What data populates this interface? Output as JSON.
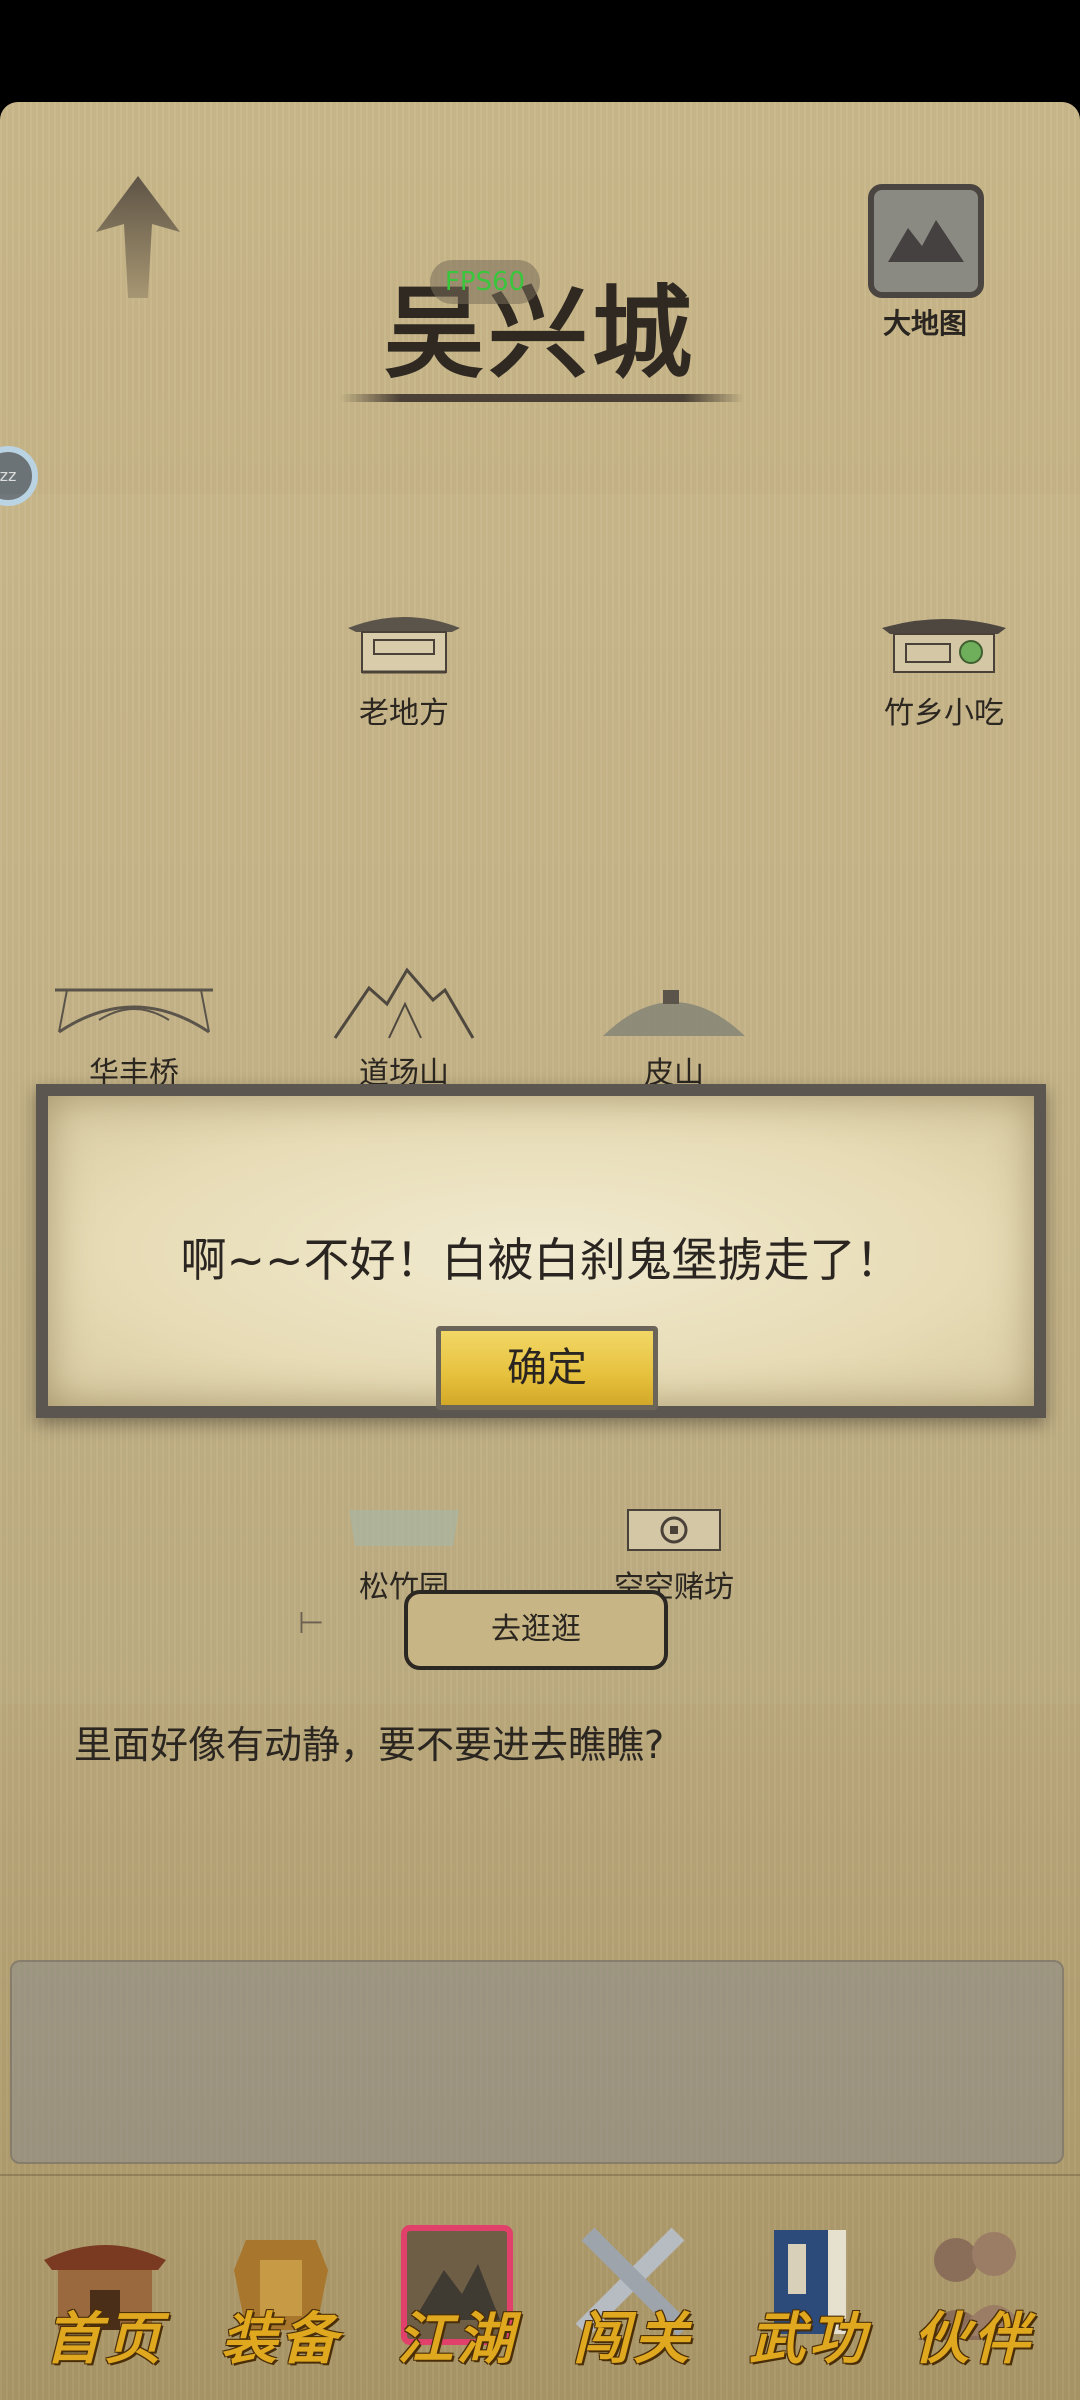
{
  "header": {
    "title": "吴兴城",
    "fps": "FPS60",
    "map_label": "大地图"
  },
  "locations": [
    {
      "label": "老地方",
      "icon": "inn-building-icon"
    },
    {
      "label": "竹乡小吃",
      "icon": "snack-shop-icon"
    },
    {
      "label": "华丰桥",
      "icon": "bridge-icon"
    },
    {
      "label": "道场山",
      "icon": "mountain-icon"
    },
    {
      "label": "皮山",
      "icon": "hill-icon"
    },
    {
      "label": "松竹园",
      "icon": "garden-icon"
    },
    {
      "label": "空空赌坊",
      "icon": "gambling-house-icon"
    }
  ],
  "go_button": "去逛逛",
  "hint": "里面好像有动静，要不要进去瞧瞧?",
  "dialog": {
    "message": "啊~~不好！白被白刹鬼堡掳走了！",
    "confirm": "确定"
  },
  "nav": [
    {
      "label": "首页",
      "icon": "home-building-icon"
    },
    {
      "label": "装备",
      "icon": "armor-icon"
    },
    {
      "label": "江湖",
      "icon": "scroll-map-icon",
      "active": true
    },
    {
      "label": "闯关",
      "icon": "crossed-swords-icon"
    },
    {
      "label": "武功",
      "icon": "book-icon"
    },
    {
      "label": "伙伴",
      "icon": "partners-icon"
    }
  ],
  "colors": {
    "background": "#c3b083",
    "nav_text": "#e0a81f",
    "fps": "#39c53c",
    "confirm_button": "#e6c13d"
  }
}
